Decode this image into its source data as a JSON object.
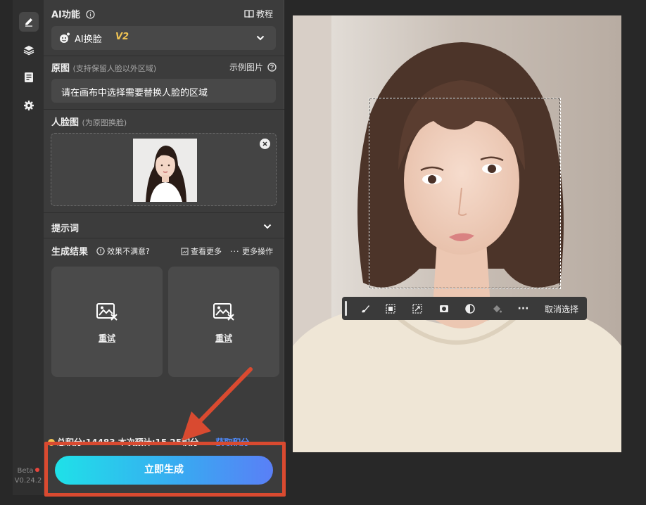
{
  "sidebar": {
    "icons": [
      "edit-icon",
      "layers-icon",
      "notes-icon",
      "gear-icon"
    ],
    "beta_label": "Beta",
    "version": "V0.24.2"
  },
  "ai_function": {
    "title": "AI功能",
    "tutorial_label": "教程",
    "selected_value": "AI换脸",
    "selected_badge": "V2"
  },
  "original": {
    "title": "原图",
    "hint": "(支持保留人脸以外区域)",
    "example_label": "示例图片",
    "placeholder": "请在画布中选择需要替换人脸的区域"
  },
  "face": {
    "title": "人脸图",
    "hint": "(为原图换脸)"
  },
  "prompt": {
    "title": "提示词"
  },
  "results": {
    "title": "生成结果",
    "feedback_label": "效果不满意?",
    "view_more_label": "查看更多",
    "more_actions_label": "更多操作",
    "cards": [
      {
        "retry_label": "重试"
      },
      {
        "retry_label": "重试"
      }
    ]
  },
  "points": {
    "text": "总积分:14483 本次预计:15 25积分",
    "get_points_label": "获取积分"
  },
  "generate_button_label": "立即生成",
  "toolbar": {
    "cancel_selection_label": "取消选择"
  },
  "colors": {
    "accent_gradient_start": "#1fe1e8",
    "accent_gradient_end": "#5a7ff6",
    "annotation_red": "#d94a30",
    "link_blue": "#4f8cff"
  }
}
